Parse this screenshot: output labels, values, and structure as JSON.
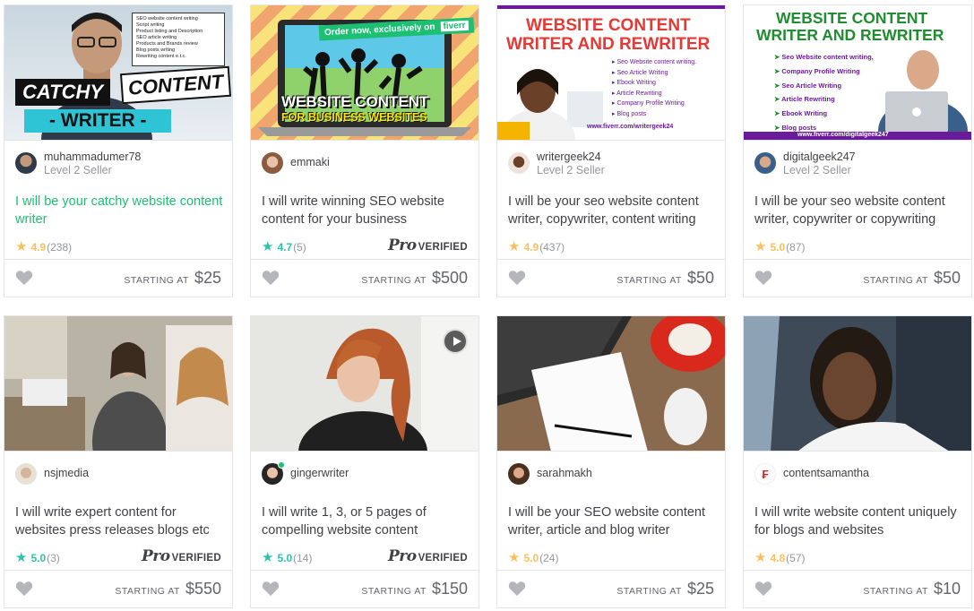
{
  "gigs": [
    {
      "seller_name": "muhammadumer78",
      "seller_level": "Level 2 Seller",
      "title": "I will be your catchy website content writer",
      "rating": "4.9",
      "reviews": "(238)",
      "pro": false,
      "starting_label": "STARTING AT",
      "price": "$25",
      "thumb": {
        "line1": "CATCHY",
        "line2": "CONTENT",
        "line3": "- WRITER -",
        "list": [
          "SEO website content writing",
          "Script writing",
          "Product listing and Description",
          "SEO article writing",
          "Products and Brands review",
          "Blog posts writing",
          "Rewriting content e.t.c."
        ]
      }
    },
    {
      "seller_name": "emmaki",
      "seller_level": "",
      "title": "I will write winning SEO website content for your business",
      "rating": "4.7",
      "reviews": "(5)",
      "pro": true,
      "pro_label": "Pro",
      "verified_label": "VERIFIED",
      "starting_label": "STARTING AT",
      "price": "$500",
      "thumb": {
        "banner": "Order now, exclusively on",
        "brand": "fiverr",
        "line1": "WEBSITE CONTENT",
        "line2": "FOR BUSINESS WEBSITES"
      }
    },
    {
      "seller_name": "writergeek24",
      "seller_level": "Level 2 Seller",
      "title": "I will be your seo website content writer, copywriter, content writing",
      "rating": "4.9",
      "reviews": "(437)",
      "pro": false,
      "starting_label": "STARTING AT",
      "price": "$50",
      "thumb": {
        "line1": "WEBSITE CONTENT",
        "line2": "WRITER AND REWRITER",
        "list": [
          "Seo Website content writing.",
          "Seo Article Writing",
          "Ebook Writing",
          "Article Rewriting",
          "Company Profile Writing",
          "Blog posts"
        ],
        "url": "www.fiverr.com/writergeek24"
      }
    },
    {
      "seller_name": "digitalgeek247",
      "seller_level": "Level 2 Seller",
      "title": "I will be your seo website content writer, copywriter or copywriting",
      "rating": "5.0",
      "reviews": "(87)",
      "pro": false,
      "starting_label": "STARTING AT",
      "price": "$50",
      "thumb": {
        "line1": "WEBSITE CONTENT",
        "line2": "WRITER AND REWRITER",
        "list": [
          "Seo Website content writing,",
          "Company Profile Writing",
          "Seo Article Writing",
          "Article Rewriting",
          "Ebook Writing",
          "Blog posts"
        ],
        "url": "www.fiverr.com/digitalgeek247"
      }
    },
    {
      "seller_name": "nsjmedia",
      "seller_level": "",
      "title": "I will write expert content for websites press releases blogs etc",
      "rating": "5.0",
      "reviews": "(3)",
      "pro": true,
      "pro_label": "Pro",
      "verified_label": "VERIFIED",
      "starting_label": "STARTING AT",
      "price": "$550",
      "thumb": {}
    },
    {
      "seller_name": "gingerwriter",
      "seller_level": "",
      "title": "I will write 1, 3, or 5 pages of compelling website content",
      "rating": "5.0",
      "reviews": "(14)",
      "pro": true,
      "pro_label": "Pro",
      "verified_label": "VERIFIED",
      "starting_label": "STARTING AT",
      "price": "$150",
      "thumb": {}
    },
    {
      "seller_name": "sarahmakh",
      "seller_level": "",
      "title": "I will be your SEO website content writer, article and blog writer",
      "rating": "5.0",
      "reviews": "(24)",
      "pro": false,
      "starting_label": "STARTING AT",
      "price": "$25",
      "thumb": {}
    },
    {
      "seller_name": "contentsamantha",
      "seller_level": "",
      "title": "I will write website content uniquely for blogs and websites",
      "rating": "4.8",
      "reviews": "(57)",
      "pro": false,
      "starting_label": "STARTING AT",
      "price": "$10",
      "thumb": {}
    }
  ],
  "colors": {
    "accent_green": "#1dbf73",
    "star_gold": "#ffbe5b",
    "star_teal": "#2cc3ae",
    "text_dark": "#404145",
    "text_muted": "#95979d",
    "border": "#e4e5e7"
  }
}
